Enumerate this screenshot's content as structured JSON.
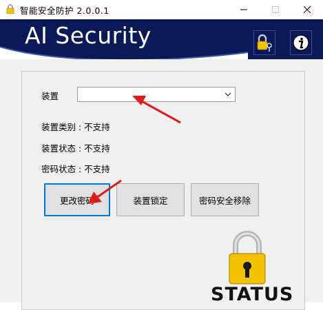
{
  "window": {
    "title": "智能安全防护 2.0.0.1",
    "icons": {
      "app": "padlock-app-icon",
      "minimize": "minimize-icon",
      "maximize": "maximize-icon",
      "close": "close-icon"
    }
  },
  "banner": {
    "title": "AI Security",
    "buttons": {
      "lock": "lock-key-icon",
      "info": "info-icon"
    }
  },
  "device": {
    "label": "装置",
    "selected_value": ""
  },
  "info": {
    "type_line": "装置类别 : 不支持",
    "status_line": "装置状态 : 不支持",
    "password_line": "密码状态 : 不支持"
  },
  "buttons": {
    "change_password": "更改密码",
    "lock_device": "装置锁定",
    "secure_remove": "密码安全移除"
  },
  "status": {
    "label": "STATUS",
    "icon": "padlock-status-icon"
  },
  "colors": {
    "banner": "#0b1957",
    "focus_border": "#0078d7",
    "arrow": "#e01b1b",
    "lock_gold": "#f2c200"
  }
}
